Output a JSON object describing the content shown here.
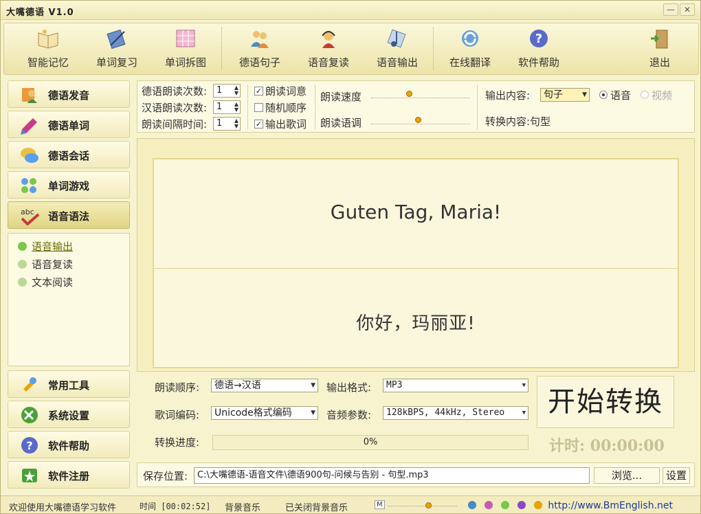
{
  "window": {
    "title": "大嘴德语 V1.0"
  },
  "toolbar": {
    "items": [
      {
        "label": "智能记忆",
        "icon": "book-icon"
      },
      {
        "label": "单词复习",
        "icon": "pen-icon"
      },
      {
        "label": "单词拆图",
        "icon": "grid-icon"
      },
      {
        "label": "德语句子",
        "icon": "people-icon"
      },
      {
        "label": "语音复读",
        "icon": "headset-icon"
      },
      {
        "label": "语音输出",
        "icon": "music-icon"
      },
      {
        "label": "在线翻译",
        "icon": "refresh-icon"
      },
      {
        "label": "软件帮助",
        "icon": "help-icon"
      },
      {
        "label": "退出",
        "icon": "exit-door-icon"
      }
    ]
  },
  "sidebar": {
    "items": [
      {
        "label": "德语发音"
      },
      {
        "label": "德语单词"
      },
      {
        "label": "德语会话"
      },
      {
        "label": "单词游戏"
      },
      {
        "label": "语音语法"
      }
    ],
    "sub_items": [
      {
        "label": "语音输出",
        "active": true
      },
      {
        "label": "语音复读"
      },
      {
        "label": "文本阅读"
      }
    ],
    "bottom_items": [
      {
        "label": "常用工具"
      },
      {
        "label": "系统设置"
      },
      {
        "label": "软件帮助"
      },
      {
        "label": "软件注册"
      }
    ]
  },
  "options": {
    "de_repeat_label": "德语朗读次数:",
    "de_repeat_value": "1",
    "cn_repeat_label": "汉语朗读次数:",
    "cn_repeat_value": "1",
    "interval_label": "朗读间隔时间:",
    "interval_value": "1",
    "read_meaning_label": "朗读词意",
    "read_meaning_checked": true,
    "random_order_label": "随机顺序",
    "random_order_checked": false,
    "output_lyrics_label": "输出歌词",
    "output_lyrics_checked": true,
    "speed_label": "朗读速度",
    "speed_level": 0.38,
    "pitch_label": "朗读语调",
    "pitch_level": 0.48,
    "output_content_label": "输出内容:",
    "output_content_value": "句子",
    "audio_radio_label": "语音",
    "video_radio_label": "视频",
    "convert_content_label": "转换内容:句型"
  },
  "display": {
    "german": "Guten Tag, Maria!",
    "chinese": "你好，玛丽亚!"
  },
  "conversion": {
    "order_label": "朗读顺序:",
    "order_value": "德语→汉语",
    "format_label": "输出格式:",
    "format_value": "MP3",
    "encoding_label": "歌词编码:",
    "encoding_value": "Unicode格式编码",
    "audio_param_label": "音频参数:",
    "audio_param_value": "128kBPS, 44kHz, Stereo",
    "progress_label": "转换进度:",
    "progress_text": "0%",
    "start_button": "开始转换",
    "timer_text": "计时: 00:00:00"
  },
  "save": {
    "label": "保存位置:",
    "path": "C:\\大嘴德语-语音文件\\德语900句-问候与告别 - 句型.mp3",
    "browse_label": "浏览...",
    "settings_label": "设置"
  },
  "status": {
    "welcome": "欢迎使用大嘴德语学习软件",
    "time_text": "时间 [00:02:52]",
    "bgm_label": "背景音乐",
    "bgm_value": "已关闭背景音乐",
    "m_label": "M",
    "url": "http://www.BmEnglish.net",
    "color_dots": [
      "#4a88c8",
      "#c85ab0",
      "#7ac84a",
      "#8a4ac8",
      "#e8a400"
    ]
  },
  "colors": {
    "accent": "#e8a400",
    "link": "#1a3a9a"
  }
}
